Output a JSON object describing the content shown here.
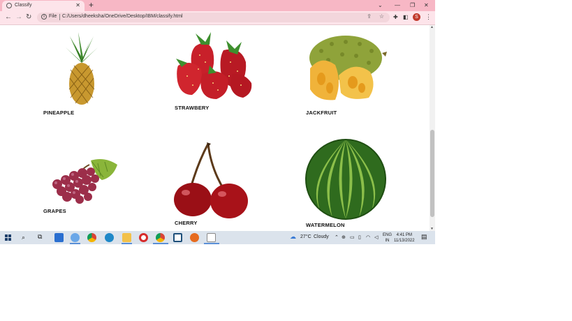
{
  "browser": {
    "tab_title": "Classify",
    "new_tab_label": "+",
    "address_scheme": "File",
    "address_url": "C:/Users/dheeksha/OneDrive/Desktop/IBM/classify.html",
    "profile_initial": "S",
    "colors": {
      "titlebar": "#f7b7c5",
      "toolbar": "#fde4ea"
    }
  },
  "fruits": [
    {
      "label": "PINEAPPLE"
    },
    {
      "label": "STRAWBERY"
    },
    {
      "label": "JACKFRUIT"
    },
    {
      "label": "GRAPES"
    },
    {
      "label": "CHERRY"
    },
    {
      "label": "WATERMELON"
    }
  ],
  "taskbar": {
    "weather_temp": "27°C",
    "weather_desc": "Cloudy",
    "lang_top": "ENG",
    "lang_bottom": "IN",
    "time": "4:41 PM",
    "date": "11/13/2022"
  }
}
